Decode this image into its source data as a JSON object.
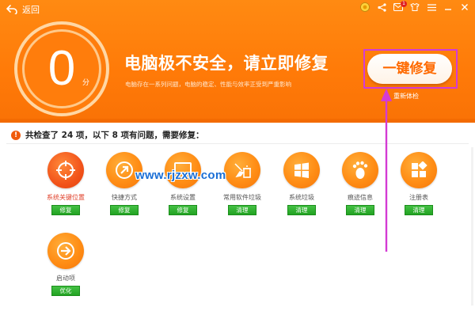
{
  "header": {
    "back_label": "返回",
    "score": "0",
    "score_unit": "分",
    "headline": "电脑极不安全，请立即修复",
    "subline": "电脑存在一系列问题，电脑的稳定、性能与效率正受到严重影响",
    "fix_button": "一键修复",
    "recheck_link": "重新体检"
  },
  "titlebar": {
    "icons": [
      "medal-icon",
      "share-icon",
      "message-icon",
      "skin-icon",
      "menu-icon",
      "minimize-icon",
      "close-icon"
    ],
    "message_badge": "1"
  },
  "summary": {
    "text": "共检查了 24 项，以下 8 项有问题，需要修复："
  },
  "issues": [
    {
      "label": "系统关键位置",
      "action": "修复",
      "icon": "target-icon"
    },
    {
      "label": "快捷方式",
      "action": "修复",
      "icon": "shortcut-arrow-icon"
    },
    {
      "label": "系统设置",
      "action": "修复",
      "icon": "monitor-icon"
    },
    {
      "label": "常用软件垃圾",
      "action": "清理",
      "icon": "broom-trash-icon"
    },
    {
      "label": "系统垃圾",
      "action": "清理",
      "icon": "windows-logo-icon"
    },
    {
      "label": "痕迹信息",
      "action": "清理",
      "icon": "footprint-icon"
    },
    {
      "label": "注册表",
      "action": "清理",
      "icon": "registry-blocks-icon"
    },
    {
      "label": "启动项",
      "action": "优化",
      "icon": "startup-arrow-icon"
    }
  ],
  "watermark": "www.rjzxw.com",
  "colors": {
    "header_orange": "#ff8410",
    "accent_green": "#2ab02a",
    "highlight_magenta": "#d43bd4",
    "alert_red": "#e0402a"
  }
}
